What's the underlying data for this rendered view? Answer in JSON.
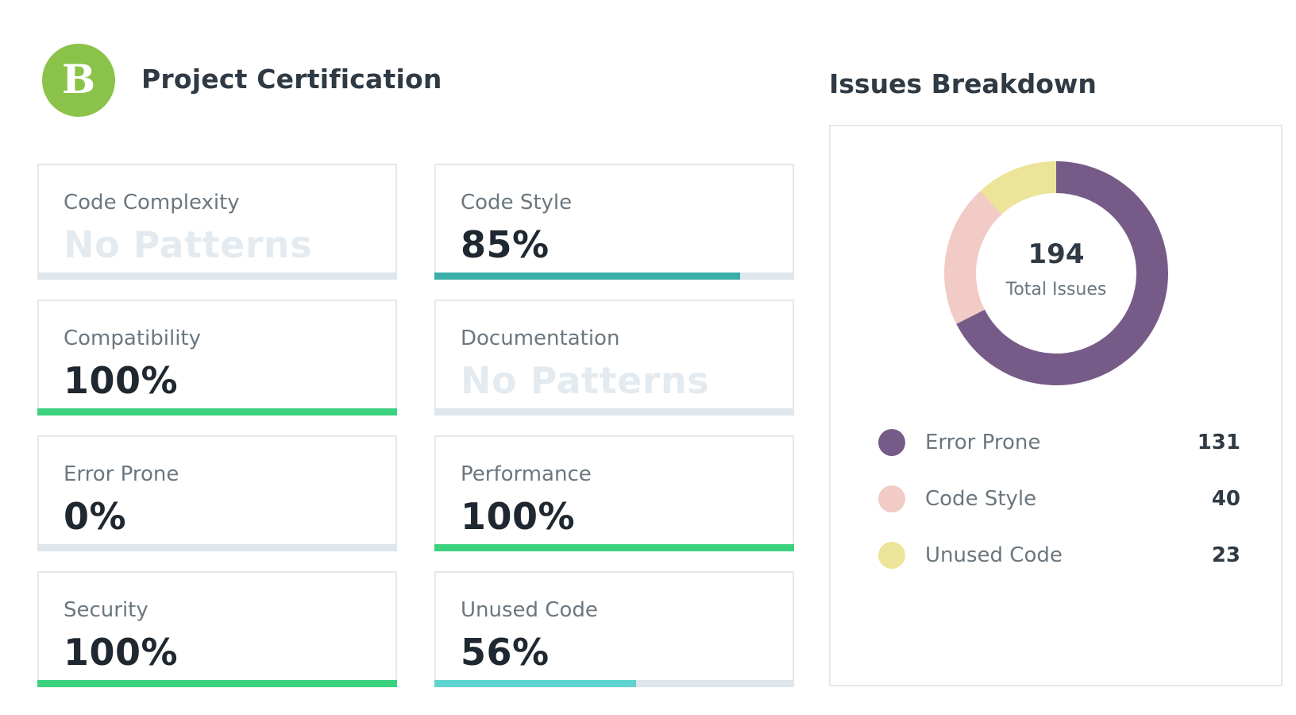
{
  "header": {
    "grade": "B",
    "title": "Project Certification"
  },
  "metrics": [
    {
      "label": "Code Complexity",
      "value": "No Patterns",
      "progress": null,
      "bar_color": "#dfe6ec"
    },
    {
      "label": "Code Style",
      "value": "85%",
      "progress": 0.85,
      "bar_color": "#3aafa9"
    },
    {
      "label": "Compatibility",
      "value": "100%",
      "progress": 1.0,
      "bar_color": "#3bd17f"
    },
    {
      "label": "Documentation",
      "value": "No Patterns",
      "progress": null,
      "bar_color": "#dfe6ec"
    },
    {
      "label": "Error Prone",
      "value": "0%",
      "progress": 0.0,
      "bar_color": "#3bd17f"
    },
    {
      "label": "Performance",
      "value": "100%",
      "progress": 1.0,
      "bar_color": "#3bd17f"
    },
    {
      "label": "Security",
      "value": "100%",
      "progress": 1.0,
      "bar_color": "#3bd17f"
    },
    {
      "label": "Unused Code",
      "value": "56%",
      "progress": 0.56,
      "bar_color": "#5fd3cf"
    }
  ],
  "breakdown": {
    "title": "Issues Breakdown",
    "total": "194",
    "total_caption": "Total Issues",
    "items": [
      {
        "label": "Error Prone",
        "count": "131",
        "value": 131,
        "color": "#765b89"
      },
      {
        "label": "Code Style",
        "count": "40",
        "value": 40,
        "color": "#f2cac6"
      },
      {
        "label": "Unused Code",
        "count": "23",
        "value": 23,
        "color": "#ece499"
      }
    ]
  }
}
